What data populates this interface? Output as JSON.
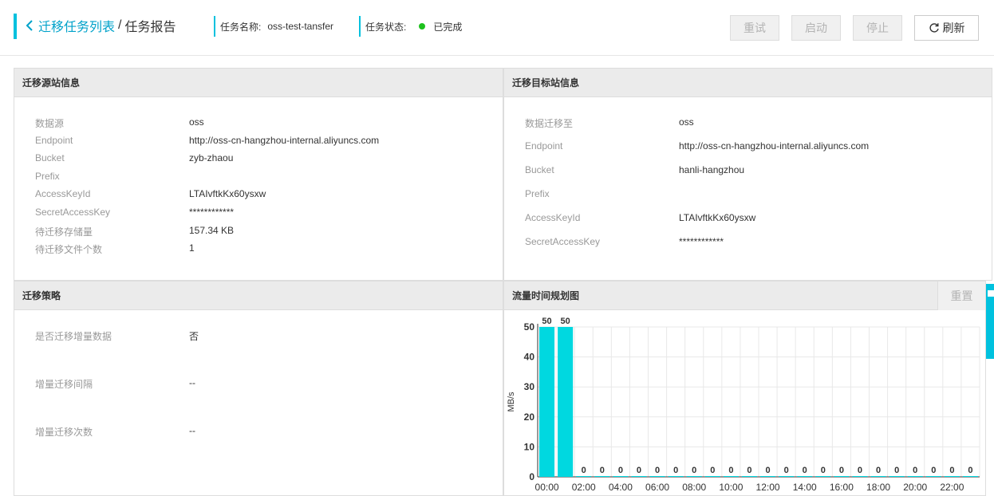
{
  "header": {
    "back_label": "迁移任务列表",
    "separator": "/",
    "current_page": "任务报告",
    "task_name_label": "任务名称:",
    "task_name_value": "oss-test-tansfer",
    "task_status_label": "任务状态:",
    "task_status_value": "已完成",
    "status_color": "#1dc11d",
    "buttons": {
      "retry": "重试",
      "start": "启动",
      "stop": "停止",
      "refresh": "刷新"
    }
  },
  "source_panel": {
    "title": "迁移源站信息",
    "rows": [
      {
        "key": "数据源",
        "value": "oss"
      },
      {
        "key": "Endpoint",
        "value": "http://oss-cn-hangzhou-internal.aliyuncs.com"
      },
      {
        "key": "Bucket",
        "value": "zyb-zhaou"
      },
      {
        "key": "Prefix",
        "value": ""
      },
      {
        "key": "AccessKeyId",
        "value": "LTAIvftkKx60ysxw"
      },
      {
        "key": "SecretAccessKey",
        "value": "************"
      },
      {
        "key": "待迁移存储量",
        "value": "157.34 KB"
      },
      {
        "key": "待迁移文件个数",
        "value": "1"
      }
    ]
  },
  "target_panel": {
    "title": "迁移目标站信息",
    "rows": [
      {
        "key": "数据迁移至",
        "value": "oss"
      },
      {
        "key": "Endpoint",
        "value": "http://oss-cn-hangzhou-internal.aliyuncs.com"
      },
      {
        "key": "Bucket",
        "value": "hanli-hangzhou"
      },
      {
        "key": "Prefix",
        "value": ""
      },
      {
        "key": "AccessKeyId",
        "value": "LTAIvftkKx60ysxw"
      },
      {
        "key": "SecretAccessKey",
        "value": "************"
      }
    ]
  },
  "strategy_panel": {
    "title": "迁移策略",
    "rows": [
      {
        "key": "是否迁移增量数据",
        "value": "否"
      },
      {
        "key": "增量迁移间隔",
        "value": "--"
      },
      {
        "key": "增量迁移次数",
        "value": "--"
      }
    ]
  },
  "chart_panel": {
    "title": "流量时间规划图",
    "reset_label": "重置"
  },
  "chart_data": {
    "type": "bar",
    "title": "",
    "xlabel": "",
    "ylabel": "MB/s",
    "ylim": [
      0,
      50
    ],
    "yticks": [
      0,
      10,
      20,
      30,
      40,
      50
    ],
    "categories": [
      "00:00",
      "01:00",
      "02:00",
      "03:00",
      "04:00",
      "05:00",
      "06:00",
      "07:00",
      "08:00",
      "09:00",
      "10:00",
      "11:00",
      "12:00",
      "13:00",
      "14:00",
      "15:00",
      "16:00",
      "17:00",
      "18:00",
      "19:00",
      "20:00",
      "21:00",
      "22:00",
      "23:00"
    ],
    "xtick_labels": [
      "00:00",
      "02:00",
      "04:00",
      "06:00",
      "08:00",
      "10:00",
      "12:00",
      "14:00",
      "16:00",
      "18:00",
      "20:00",
      "22:00"
    ],
    "values": [
      50,
      50,
      0,
      0,
      0,
      0,
      0,
      0,
      0,
      0,
      0,
      0,
      0,
      0,
      0,
      0,
      0,
      0,
      0,
      0,
      0,
      0,
      0,
      0
    ],
    "bar_color": "#00d8e0",
    "grid": true
  },
  "colors": {
    "accent": "#00c1de",
    "link": "#00a2ca"
  }
}
